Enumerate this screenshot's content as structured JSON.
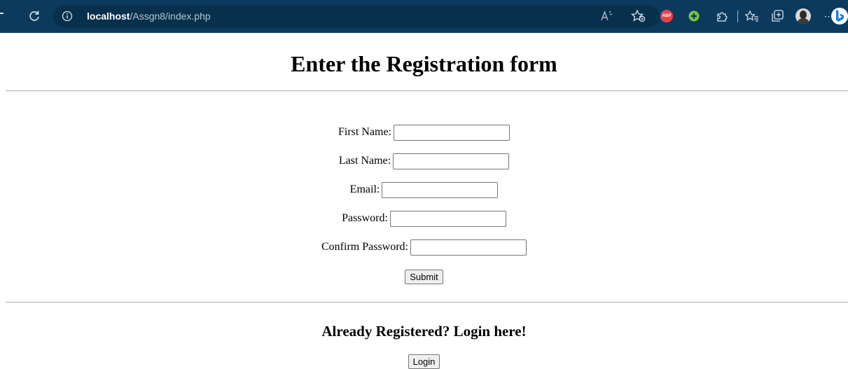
{
  "browser": {
    "url_host": "localhost",
    "url_path": "/Assgn8/index.php",
    "extension_badge": "ABP"
  },
  "page": {
    "title": "Enter the Registration form",
    "form": {
      "first_name_label": "First Name:",
      "first_name_value": "",
      "last_name_label": "Last Name:",
      "last_name_value": "",
      "email_label": "Email:",
      "email_value": "",
      "password_label": "Password:",
      "password_value": "",
      "confirm_password_label": "Confirm Password:",
      "confirm_password_value": "",
      "submit_label": "Submit"
    },
    "login_heading": "Already Registered? Login here!",
    "login_label": "Login"
  },
  "colors": {
    "toolbar_background": "#0b3a5c",
    "address_bar_background": "#07304d",
    "divider": "#b5b5b5"
  },
  "icons": [
    "refresh-icon",
    "info-icon",
    "read-aloud-icon",
    "add-favorite-icon",
    "adblock-plus-icon",
    "green-extension-icon",
    "extensions-icon",
    "favorites-icon",
    "collections-icon",
    "profile-avatar",
    "more-icon",
    "copilot-icon"
  ]
}
